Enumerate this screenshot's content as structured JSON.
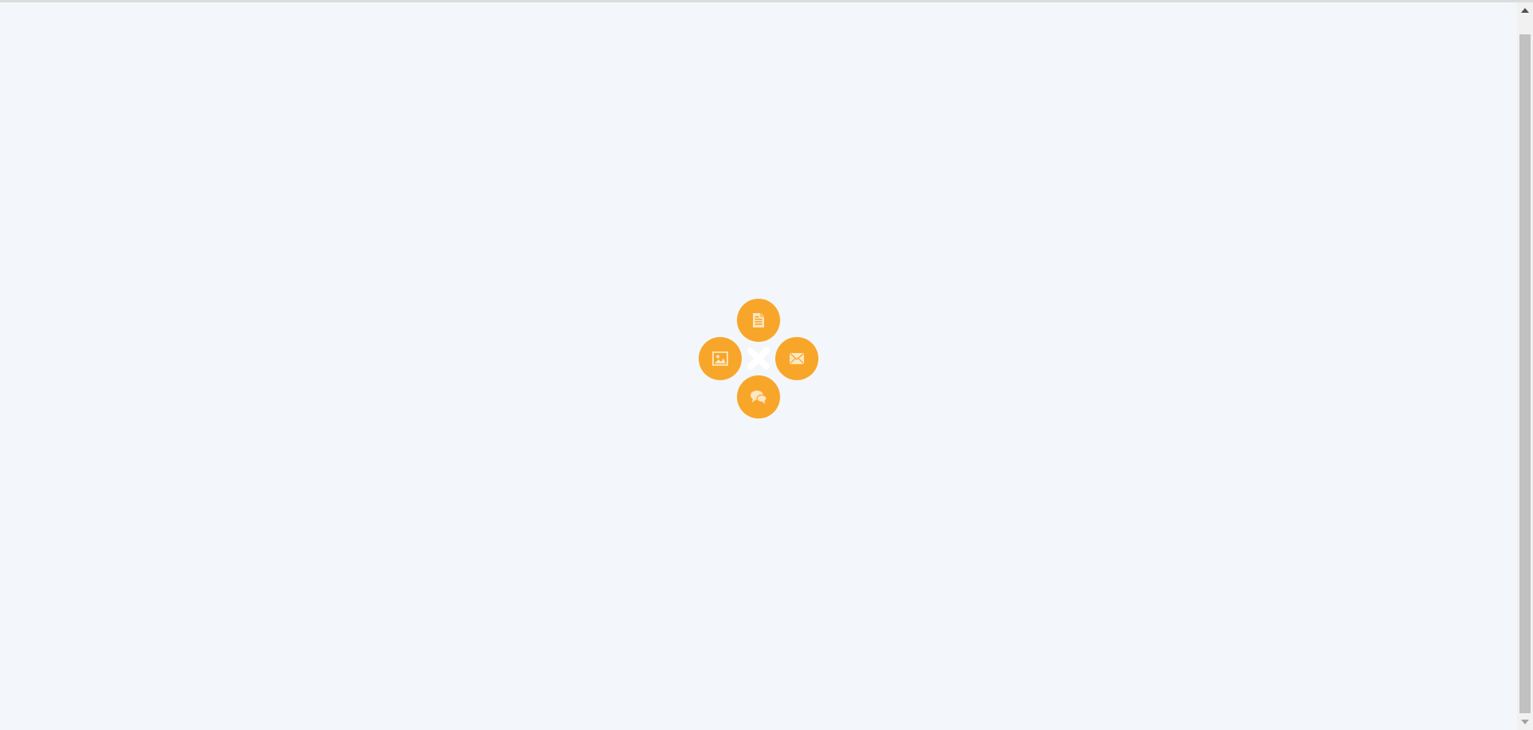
{
  "colors": {
    "background": "#f3f7fb",
    "accent": "#f8a62a",
    "icon": "#fde6c0",
    "close": "#ffffff"
  },
  "radial_menu": {
    "center": {
      "icon": "close-icon"
    },
    "items": [
      {
        "id": "document",
        "icon": "document-icon"
      },
      {
        "id": "image",
        "icon": "image-icon"
      },
      {
        "id": "mail",
        "icon": "mail-icon"
      },
      {
        "id": "chat",
        "icon": "chat-icon"
      }
    ]
  }
}
